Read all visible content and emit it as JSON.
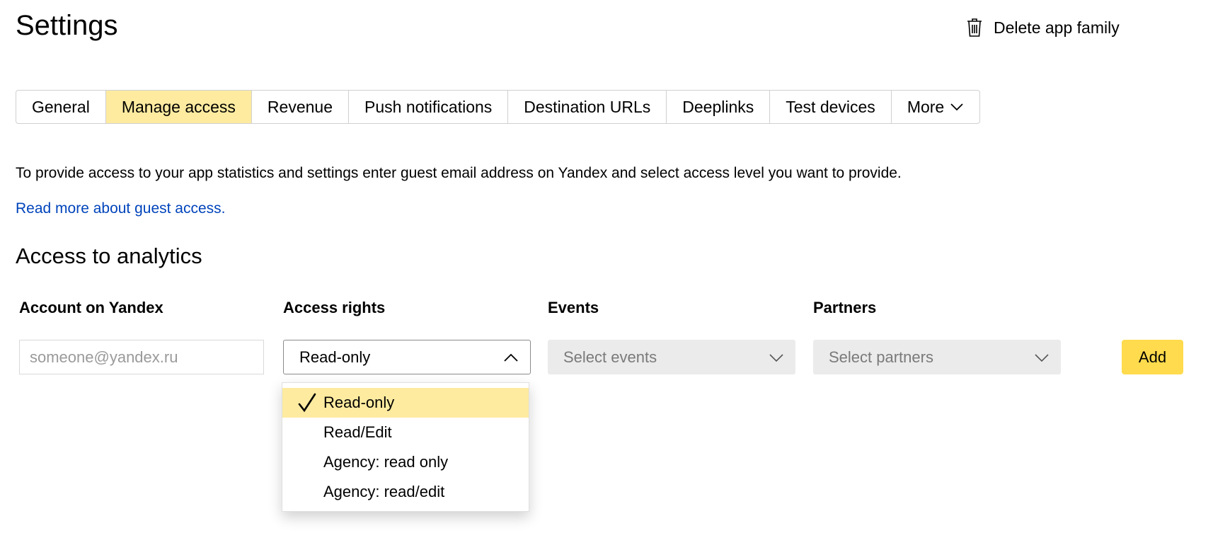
{
  "header": {
    "title": "Settings",
    "delete_label": "Delete app family",
    "delete_icon": "trash-icon"
  },
  "tabs": [
    {
      "label": "General",
      "active": false
    },
    {
      "label": "Manage access",
      "active": true
    },
    {
      "label": "Revenue",
      "active": false
    },
    {
      "label": "Push notifications",
      "active": false
    },
    {
      "label": "Destination URLs",
      "active": false
    },
    {
      "label": "Deeplinks",
      "active": false
    },
    {
      "label": "Test devices",
      "active": false
    },
    {
      "label": "More",
      "active": false,
      "icon": "chevron-down-icon"
    }
  ],
  "intro": {
    "text": "To provide access to your app statistics and settings enter guest email address on Yandex and select access level you want to provide.",
    "link": "Read more about guest access."
  },
  "analytics": {
    "title": "Access to analytics",
    "columns": {
      "account": "Account on Yandex",
      "rights": "Access rights",
      "events": "Events",
      "partners": "Partners"
    },
    "account_input": {
      "value": "",
      "placeholder": "someone@yandex.ru"
    },
    "rights_select": {
      "value": "Read-only",
      "open": true,
      "options": [
        "Read-only",
        "Read/Edit",
        "Agency: read only",
        "Agency: read/edit"
      ],
      "selected_index": 0
    },
    "events_select": {
      "placeholder": "Select events"
    },
    "partners_select": {
      "placeholder": "Select partners"
    },
    "add_label": "Add"
  },
  "colors": {
    "accent_yellow": "#ffdb4d",
    "active_tab": "#ffeba0",
    "link": "#0044bb",
    "disabled_bg": "#ebebeb"
  }
}
